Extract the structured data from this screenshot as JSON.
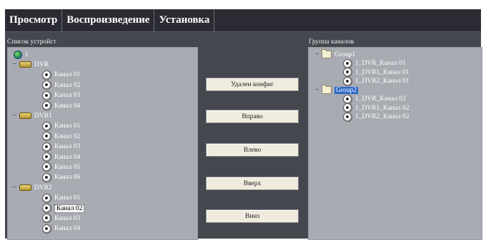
{
  "menu": [
    "Просмотр",
    "Воспроизведение",
    "Установка"
  ],
  "device_list": {
    "title": "Список устройст",
    "root": "1",
    "devices": [
      {
        "name": "DVR",
        "channels": [
          "Канал 01",
          "Канал 02",
          "Канал 03",
          "Канал 04"
        ]
      },
      {
        "name": "DVR1",
        "channels": [
          "Канал 01",
          "Канал 02",
          "Канал 03",
          "Канал 04",
          "Канал 05",
          "Канал 06"
        ]
      },
      {
        "name": "DVR2",
        "channels": [
          "Канал 01",
          "Канал 02",
          "Канал 03",
          "Канал 04"
        ]
      }
    ],
    "selected": {
      "device": "DVR2",
      "channel": "Канал 02"
    }
  },
  "buttons": [
    "Удален конфиг",
    "Вправо",
    "Влево",
    "Вверх",
    "Вниз"
  ],
  "channel_groups": {
    "title": "Группа каналов",
    "groups": [
      {
        "name": "Group1",
        "items": [
          "1_DVR_Канал 01",
          "1_DVR1_Канал 01",
          "1_DVR2_Канал 01"
        ]
      },
      {
        "name": "Group2",
        "items": [
          "1_DVR_Канал 02",
          "1_DVR1_Канал 02",
          "1_DVR2_Канал 02"
        ]
      }
    ],
    "highlighted": "Group2"
  },
  "tree_toggle_symbol": "−",
  "colors": {
    "background": "#45474f",
    "menubar": "#2b2c33",
    "panel": "#a9abb2",
    "highlight": "#2f68c8"
  }
}
